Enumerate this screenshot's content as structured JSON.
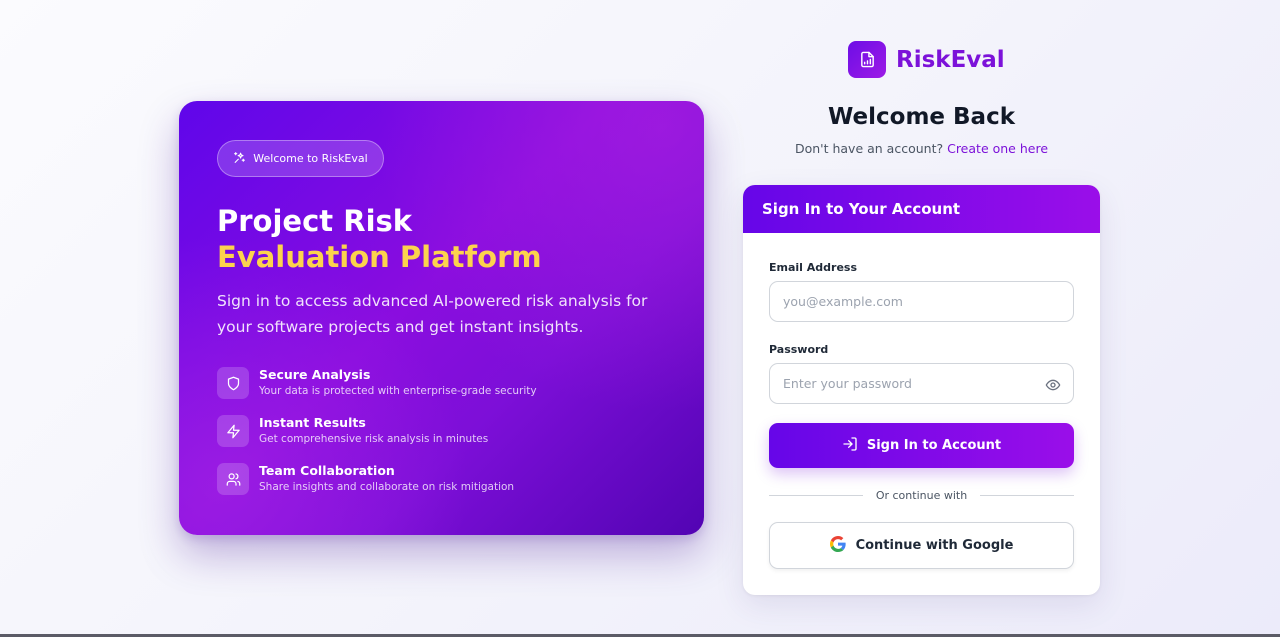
{
  "hero": {
    "badge_icon": "sparkles-icon",
    "badge_label": "Welcome to RiskEval",
    "title_line1": "Project Risk",
    "title_line2": "Evaluation Platform",
    "description": "Sign in to access advanced AI-powered risk analysis for your software projects and get instant insights.",
    "features": [
      {
        "icon": "shield-icon",
        "title": "Secure Analysis",
        "description": "Your data is protected with enterprise-grade security"
      },
      {
        "icon": "lightning-icon",
        "title": "Instant Results",
        "description": "Get comprehensive risk analysis in minutes"
      },
      {
        "icon": "users-icon",
        "title": "Team Collaboration",
        "description": "Share insights and collaborate on risk mitigation"
      }
    ],
    "accent_color": "#fcd34d"
  },
  "brand": {
    "logo_icon": "document-chart-icon",
    "name": "RiskEval",
    "color": "#7c12d9"
  },
  "welcome": {
    "title": "Welcome Back",
    "subtitle": "Don't have an account?",
    "create_link": "Create one here"
  },
  "form": {
    "header": "Sign In to Your Account",
    "email": {
      "label": "Email Address",
      "placeholder": "you@example.com",
      "value": ""
    },
    "password": {
      "label": "Password",
      "placeholder": "Enter your password",
      "value": "",
      "toggle_icon": "eye-icon"
    },
    "submit_label": "Sign In to Account",
    "submit_icon": "sign-in-icon",
    "divider_text": "Or continue with",
    "google_label": "Continue with Google",
    "google_icon": "google-icon"
  },
  "colors": {
    "primary_start": "#6606e8",
    "primary_end": "#9a0ee9"
  }
}
